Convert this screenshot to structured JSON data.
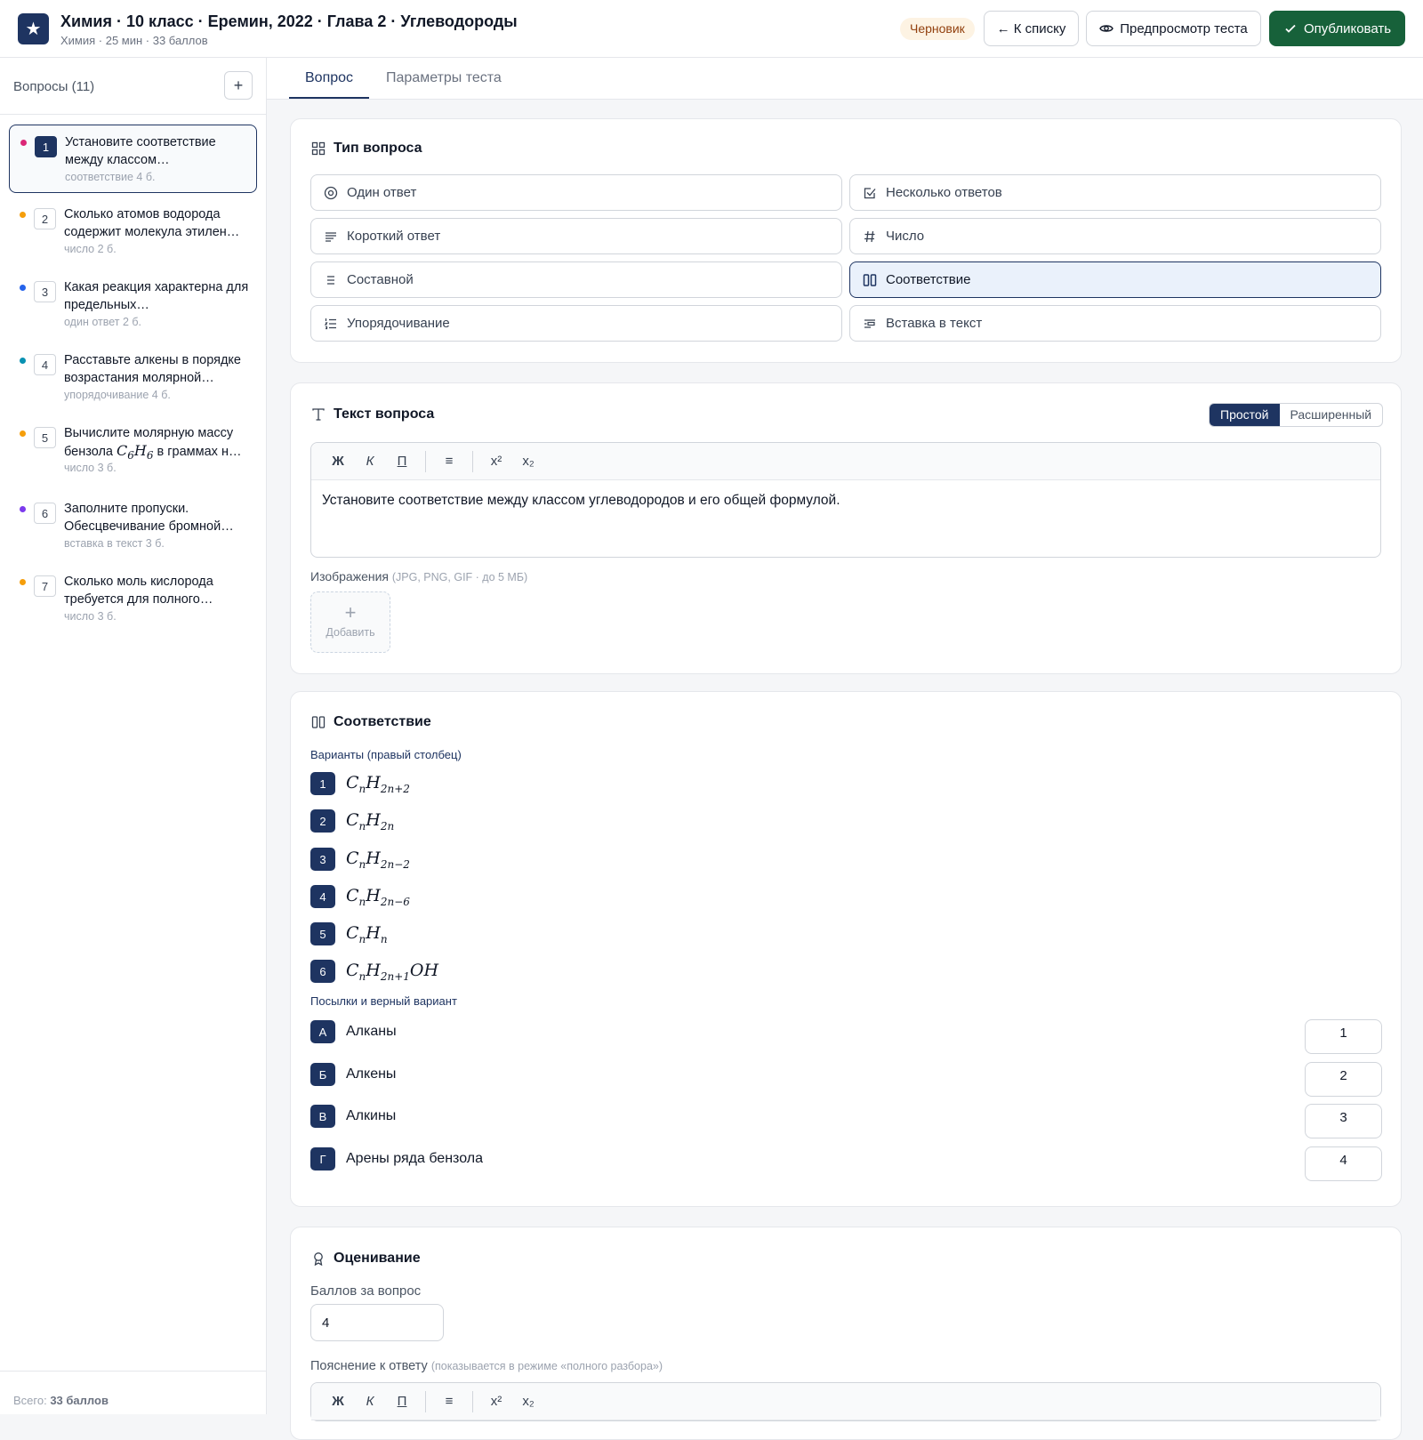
{
  "header": {
    "title": "Химия · 10 класс · Еремин, 2022 · Глава 2 · Углеводороды",
    "subtitle": "Химия · 25 мин · 33 баллов",
    "status_badge": "Черновик",
    "back_label": "← К списку",
    "preview_label": "Предпросмотр теста",
    "publish_label": "Опубликовать"
  },
  "sidebar": {
    "heading": "Вопросы (11)",
    "add_label": "+",
    "total_prefix": "Всего:",
    "total_value": "33 баллов",
    "items": [
      {
        "num": "1",
        "text": "Установите соответствие между классом…",
        "meta": "соответствие  4 б.",
        "dot": "#db2777"
      },
      {
        "num": "2",
        "text": "Сколько атомов водорода содержит молекула этилен…",
        "meta": "число  2 б.",
        "dot": "#f59e0b"
      },
      {
        "num": "3",
        "text": "Какая реакция характерна для предельных…",
        "meta": "один ответ  2 б.",
        "dot": "#2563eb"
      },
      {
        "num": "4",
        "text": "Расставьте алкены в порядке возрастания молярной…",
        "meta": "упорядочивание  4 б.",
        "dot": "#0891b2"
      },
      {
        "num": "5",
        "text_pre": "Вычислите молярную массу бензола ",
        "text_post": " в граммах н…",
        "meta": "число  3 б.",
        "dot": "#f59e0b"
      },
      {
        "num": "6",
        "text": "Заполните пропуски. Обесцвечивание бромной…",
        "meta": "вставка в текст  3 б.",
        "dot": "#7c3aed"
      },
      {
        "num": "7",
        "text": "Сколько моль кислорода требуется для полного…",
        "meta": "число  3 б.",
        "dot": "#f59e0b"
      }
    ]
  },
  "tabs": {
    "question": "Вопрос",
    "settings": "Параметры теста"
  },
  "question_type": {
    "title": "Тип вопроса",
    "options": [
      {
        "label": "Один ответ",
        "icon": "radio-icon"
      },
      {
        "label": "Несколько ответов",
        "icon": "checkbox-icon"
      },
      {
        "label": "Короткий ответ",
        "icon": "text-lines-icon"
      },
      {
        "label": "Число",
        "icon": "hash-icon"
      },
      {
        "label": "Составной",
        "icon": "list-icon"
      },
      {
        "label": "Соответствие",
        "icon": "columns-icon",
        "selected": true
      },
      {
        "label": "Упорядочивание",
        "icon": "ordered-list-icon"
      },
      {
        "label": "Вставка в текст",
        "icon": "insert-text-icon"
      }
    ]
  },
  "question_text": {
    "title": "Текст вопроса",
    "mode_simple": "Простой",
    "mode_advanced": "Расширенный",
    "toolbar": {
      "bold": "Ж",
      "italic": "К",
      "underline": "П",
      "list": "≡",
      "sup": "x²",
      "sub": "x₂"
    },
    "body": "Установите соответствие между классом углеводородов и его общей формулой.",
    "images_label": "Изображения",
    "images_hint": "(JPG, PNG, GIF · до 5 МБ)",
    "add_image_plus": "+",
    "add_image_label": "Добавить"
  },
  "matching": {
    "title": "Соответствие",
    "variants_label": "Варианты (правый столбец)",
    "variants": [
      {
        "num": "1",
        "base": "H",
        "sub": "2n+2",
        "tail": ""
      },
      {
        "num": "2",
        "base": "H",
        "sub": "2n",
        "tail": ""
      },
      {
        "num": "3",
        "base": "H",
        "sub": "2n−2",
        "tail": ""
      },
      {
        "num": "4",
        "base": "H",
        "sub": "2n−6",
        "tail": ""
      },
      {
        "num": "5",
        "base": "H",
        "sub": "n",
        "tail": ""
      },
      {
        "num": "6",
        "base": "H",
        "sub": "2n+1",
        "tail": "OH"
      }
    ],
    "premises_label": "Посылки и верный вариант",
    "premises": [
      {
        "letter": "А",
        "text": "Алканы",
        "answer": "1"
      },
      {
        "letter": "Б",
        "text": "Алкены",
        "answer": "2"
      },
      {
        "letter": "В",
        "text": "Алкины",
        "answer": "3"
      },
      {
        "letter": "Г",
        "text": "Арены ряда бензола",
        "answer": "4"
      }
    ]
  },
  "grading": {
    "title": "Оценивание",
    "points_label": "Баллов за вопрос",
    "points_value": "4",
    "explanation_label": "Пояснение к ответу",
    "explanation_hint": "(показывается в режиме «полного разбора»)"
  },
  "colors": {
    "navy": "#1e3461",
    "green": "#17613a"
  }
}
